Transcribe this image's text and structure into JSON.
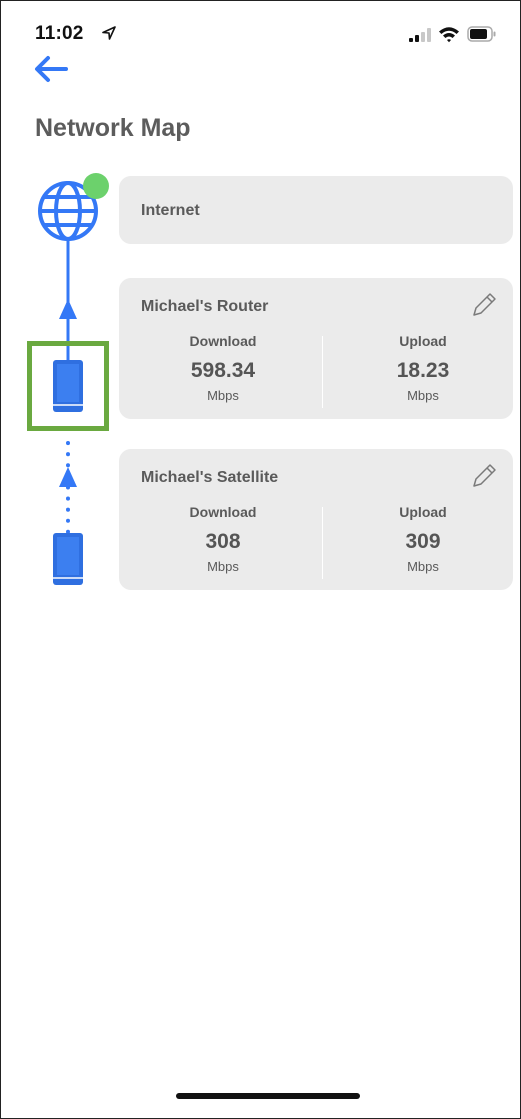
{
  "status_bar": {
    "time": "11:02"
  },
  "header": {
    "title": "Network Map"
  },
  "nodes": {
    "internet": {
      "name": "Internet"
    },
    "router": {
      "name": "Michael's Router",
      "download": {
        "label": "Download",
        "value": "598.34",
        "unit": "Mbps"
      },
      "upload": {
        "label": "Upload",
        "value": "18.23",
        "unit": "Mbps"
      }
    },
    "satellite": {
      "name": "Michael's Satellite",
      "download": {
        "label": "Download",
        "value": "308",
        "unit": "Mbps"
      },
      "upload": {
        "label": "Upload",
        "value": "309",
        "unit": "Mbps"
      }
    }
  },
  "colors": {
    "accent": "#3478f6",
    "device_blue": "#2f6fe0",
    "online_dot": "#6cd16c",
    "highlight": "#6aa940",
    "card_bg": "#ebebeb"
  },
  "icons": [
    "location-arrow-icon",
    "signal-icon",
    "wifi-icon",
    "battery-icon",
    "back-arrow-icon",
    "globe-icon",
    "router-icon",
    "satellite-icon",
    "pencil-icon"
  ]
}
